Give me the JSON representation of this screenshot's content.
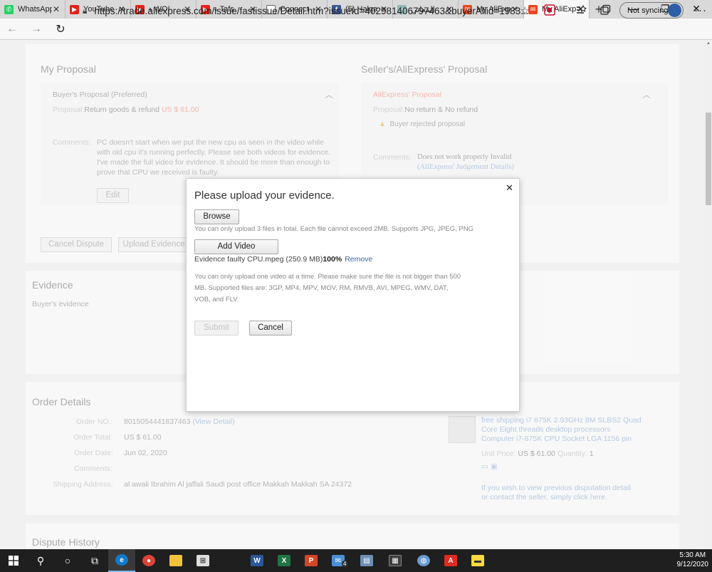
{
  "browser": {
    "tabs": [
      {
        "title": "WhatsApp",
        "color": "#25d366",
        "glyph": "✆",
        "muted": false
      },
      {
        "title": "YouTube",
        "color": "#e62117",
        "glyph": "▶",
        "muted": false
      },
      {
        "title": "WOI",
        "color": "#e62117",
        "glyph": "▶",
        "muted": true
      },
      {
        "title": "Tafs",
        "color": "#e62117",
        "glyph": "▶",
        "muted": true
      },
      {
        "title": "Connect",
        "color": "#ffffff",
        "glyph": "",
        "muted": false
      },
      {
        "title": "(5) Halqa",
        "color": "#3b5998",
        "glyph": "f",
        "muted": false
      },
      {
        "title": "المعاني",
        "color": "#8fb8b8",
        "glyph": "~",
        "muted": false
      },
      {
        "title": "My AliExp",
        "color": "#e8461f",
        "glyph": "✉",
        "muted": false
      },
      {
        "title": "My AliExp",
        "color": "#e8461f",
        "glyph": "✉",
        "muted": false,
        "active": true
      }
    ],
    "url": "https://trade.aliexpress.com/issue/fastissue/Detail.htm?issueId=402981406797463&buyerAliid=1983...",
    "sync_label": "Not syncing"
  },
  "proposal": {
    "my_title": "My Proposal",
    "seller_title": "Seller's/AliExpress' Proposal",
    "buyer_label": "Buyer's Proposal (Preferred)",
    "proposal_key": "Proposal:",
    "buyer_value": "Return goods & refund",
    "buyer_amount": "US $ 61.00",
    "comments_key": "Comments:",
    "buyer_comment": "PC doesn't start when we put the new cpu as seen in the video while with old cpu it's running perfectly. Please see both videos for evidence. I've made the full video for evidence. It should be more than enough to prove that CPU we received is faulty.",
    "edit_label": "Edit",
    "ali_label": "AliExpress' Proposal",
    "ali_value": "No return & No refund",
    "rejected": "Buyer rejected proposal",
    "ali_comment": "Does not work properly  Invalid",
    "ali_link": "(AliExpress' Judgement Details)",
    "cancel_dispute": "Cancel Dispute",
    "upload_evidence": "Upload Evidence"
  },
  "evidence": {
    "title": "Evidence",
    "buyer_evidence": "Buyer's evidence"
  },
  "order": {
    "title": "Order Details",
    "order_no_key": "Order NO.:",
    "order_no": "8015054441837463",
    "view_detail": "(View Detail)",
    "total_key": "Order Total:",
    "total": "US $ 61.00",
    "date_key": "Order Date:",
    "date": "Jun 02, 2020",
    "comments_key": "Comments:",
    "address_key": "Shipping Address:",
    "address": "al awali Ibrahim Al jaffali Saudi post office Makkah Makkah SA 24372",
    "product_title": "free shipping i7 875K 2.93GHz 8M SLBS2 Quad Core Eight threads desktop processors Computer i7-875K CPU Socket LGA 1156 pin",
    "unit_price_key": "Unit Price:",
    "unit_price": "US $ 61.00",
    "quantity_key": "Quantity:",
    "quantity": "1",
    "previous_link": "If you wish to view previous disputation detail or contact the seller, simply click here."
  },
  "dispute_history": {
    "title": "Dispute History"
  },
  "modal": {
    "title": "Please upload your evidence.",
    "browse_label": "Browse",
    "browse_hint": "You can only upload 3 files in total. Each file cannot exceed 2MB. Supports JPG, JPEG, PNG",
    "add_video_label": "Add Video",
    "file_name": "Evidence faulty CPU.mpeg (250.9 MB)",
    "file_progress": "100%",
    "remove_label": "Remove",
    "video_hint": "You can only upload one video at a time. Please make sure the file is not bigger than 500 MB. Supported files are: 3GP, MP4, MPV, MOV, RM, RMVB, AVI, MPEG, WMV, DAT, VOB, and FLV.",
    "submit_label": "Submit",
    "cancel_label": "Cancel"
  },
  "taskbar": {
    "time": "5:30 AM",
    "date": "9/12/2020",
    "mail_badge": "4"
  }
}
